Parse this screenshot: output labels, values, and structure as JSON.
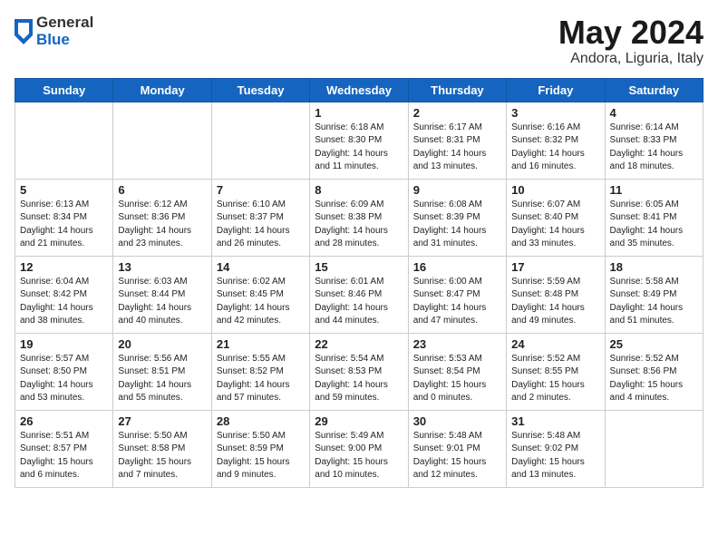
{
  "logo": {
    "general": "General",
    "blue": "Blue"
  },
  "header": {
    "month": "May 2024",
    "location": "Andora, Liguria, Italy"
  },
  "weekdays": [
    "Sunday",
    "Monday",
    "Tuesday",
    "Wednesday",
    "Thursday",
    "Friday",
    "Saturday"
  ],
  "weeks": [
    [
      {
        "day": "",
        "info": ""
      },
      {
        "day": "",
        "info": ""
      },
      {
        "day": "",
        "info": ""
      },
      {
        "day": "1",
        "info": "Sunrise: 6:18 AM\nSunset: 8:30 PM\nDaylight: 14 hours\nand 11 minutes."
      },
      {
        "day": "2",
        "info": "Sunrise: 6:17 AM\nSunset: 8:31 PM\nDaylight: 14 hours\nand 13 minutes."
      },
      {
        "day": "3",
        "info": "Sunrise: 6:16 AM\nSunset: 8:32 PM\nDaylight: 14 hours\nand 16 minutes."
      },
      {
        "day": "4",
        "info": "Sunrise: 6:14 AM\nSunset: 8:33 PM\nDaylight: 14 hours\nand 18 minutes."
      }
    ],
    [
      {
        "day": "5",
        "info": "Sunrise: 6:13 AM\nSunset: 8:34 PM\nDaylight: 14 hours\nand 21 minutes."
      },
      {
        "day": "6",
        "info": "Sunrise: 6:12 AM\nSunset: 8:36 PM\nDaylight: 14 hours\nand 23 minutes."
      },
      {
        "day": "7",
        "info": "Sunrise: 6:10 AM\nSunset: 8:37 PM\nDaylight: 14 hours\nand 26 minutes."
      },
      {
        "day": "8",
        "info": "Sunrise: 6:09 AM\nSunset: 8:38 PM\nDaylight: 14 hours\nand 28 minutes."
      },
      {
        "day": "9",
        "info": "Sunrise: 6:08 AM\nSunset: 8:39 PM\nDaylight: 14 hours\nand 31 minutes."
      },
      {
        "day": "10",
        "info": "Sunrise: 6:07 AM\nSunset: 8:40 PM\nDaylight: 14 hours\nand 33 minutes."
      },
      {
        "day": "11",
        "info": "Sunrise: 6:05 AM\nSunset: 8:41 PM\nDaylight: 14 hours\nand 35 minutes."
      }
    ],
    [
      {
        "day": "12",
        "info": "Sunrise: 6:04 AM\nSunset: 8:42 PM\nDaylight: 14 hours\nand 38 minutes."
      },
      {
        "day": "13",
        "info": "Sunrise: 6:03 AM\nSunset: 8:44 PM\nDaylight: 14 hours\nand 40 minutes."
      },
      {
        "day": "14",
        "info": "Sunrise: 6:02 AM\nSunset: 8:45 PM\nDaylight: 14 hours\nand 42 minutes."
      },
      {
        "day": "15",
        "info": "Sunrise: 6:01 AM\nSunset: 8:46 PM\nDaylight: 14 hours\nand 44 minutes."
      },
      {
        "day": "16",
        "info": "Sunrise: 6:00 AM\nSunset: 8:47 PM\nDaylight: 14 hours\nand 47 minutes."
      },
      {
        "day": "17",
        "info": "Sunrise: 5:59 AM\nSunset: 8:48 PM\nDaylight: 14 hours\nand 49 minutes."
      },
      {
        "day": "18",
        "info": "Sunrise: 5:58 AM\nSunset: 8:49 PM\nDaylight: 14 hours\nand 51 minutes."
      }
    ],
    [
      {
        "day": "19",
        "info": "Sunrise: 5:57 AM\nSunset: 8:50 PM\nDaylight: 14 hours\nand 53 minutes."
      },
      {
        "day": "20",
        "info": "Sunrise: 5:56 AM\nSunset: 8:51 PM\nDaylight: 14 hours\nand 55 minutes."
      },
      {
        "day": "21",
        "info": "Sunrise: 5:55 AM\nSunset: 8:52 PM\nDaylight: 14 hours\nand 57 minutes."
      },
      {
        "day": "22",
        "info": "Sunrise: 5:54 AM\nSunset: 8:53 PM\nDaylight: 14 hours\nand 59 minutes."
      },
      {
        "day": "23",
        "info": "Sunrise: 5:53 AM\nSunset: 8:54 PM\nDaylight: 15 hours\nand 0 minutes."
      },
      {
        "day": "24",
        "info": "Sunrise: 5:52 AM\nSunset: 8:55 PM\nDaylight: 15 hours\nand 2 minutes."
      },
      {
        "day": "25",
        "info": "Sunrise: 5:52 AM\nSunset: 8:56 PM\nDaylight: 15 hours\nand 4 minutes."
      }
    ],
    [
      {
        "day": "26",
        "info": "Sunrise: 5:51 AM\nSunset: 8:57 PM\nDaylight: 15 hours\nand 6 minutes."
      },
      {
        "day": "27",
        "info": "Sunrise: 5:50 AM\nSunset: 8:58 PM\nDaylight: 15 hours\nand 7 minutes."
      },
      {
        "day": "28",
        "info": "Sunrise: 5:50 AM\nSunset: 8:59 PM\nDaylight: 15 hours\nand 9 minutes."
      },
      {
        "day": "29",
        "info": "Sunrise: 5:49 AM\nSunset: 9:00 PM\nDaylight: 15 hours\nand 10 minutes."
      },
      {
        "day": "30",
        "info": "Sunrise: 5:48 AM\nSunset: 9:01 PM\nDaylight: 15 hours\nand 12 minutes."
      },
      {
        "day": "31",
        "info": "Sunrise: 5:48 AM\nSunset: 9:02 PM\nDaylight: 15 hours\nand 13 minutes."
      },
      {
        "day": "",
        "info": ""
      }
    ]
  ]
}
